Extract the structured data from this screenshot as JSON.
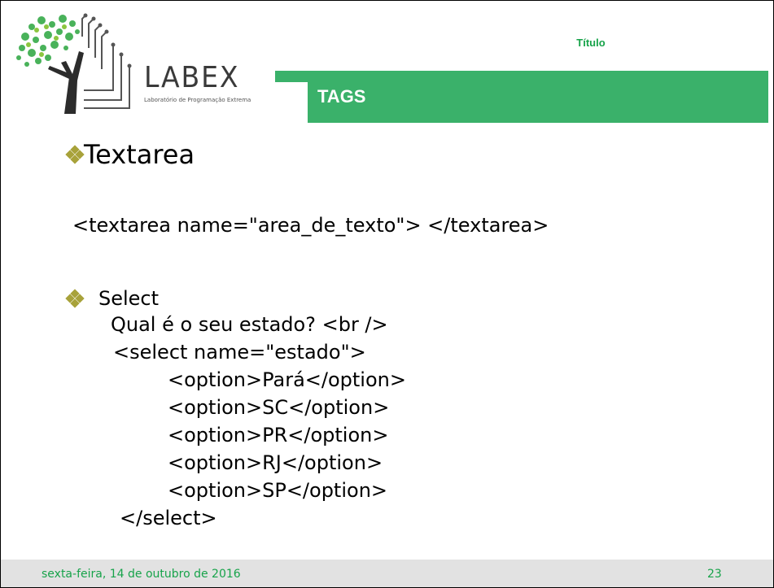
{
  "logo": {
    "word": "LABEX",
    "subtitle": "Laboratório de Programação Extrema"
  },
  "header": {
    "title": "Título",
    "band_label": "TAGS"
  },
  "content": {
    "heading_textarea": "Textarea",
    "textarea_code": "<textarea name=\"area_de_texto\"> </textarea>",
    "heading_select": "Select",
    "select_lines": [
      "Qual é o seu estado? <br />",
      "<select name=\"estado\">",
      "<option>Pará</option>",
      "<option>SC</option>",
      "<option>PR</option>",
      "<option>RJ</option>",
      "<option>SP</option>",
      "</select>"
    ]
  },
  "footer": {
    "date": "sexta-feira, 14 de outubro de 2016",
    "page_number": "23"
  },
  "colors": {
    "accent_green": "#3ab16a",
    "text_green": "#17a34a",
    "bullet_olive": "#a8a23a",
    "footer_gray": "#e2e2e2"
  },
  "icons": [
    "tree-logo-icon",
    "diamond-bullet-icon"
  ]
}
